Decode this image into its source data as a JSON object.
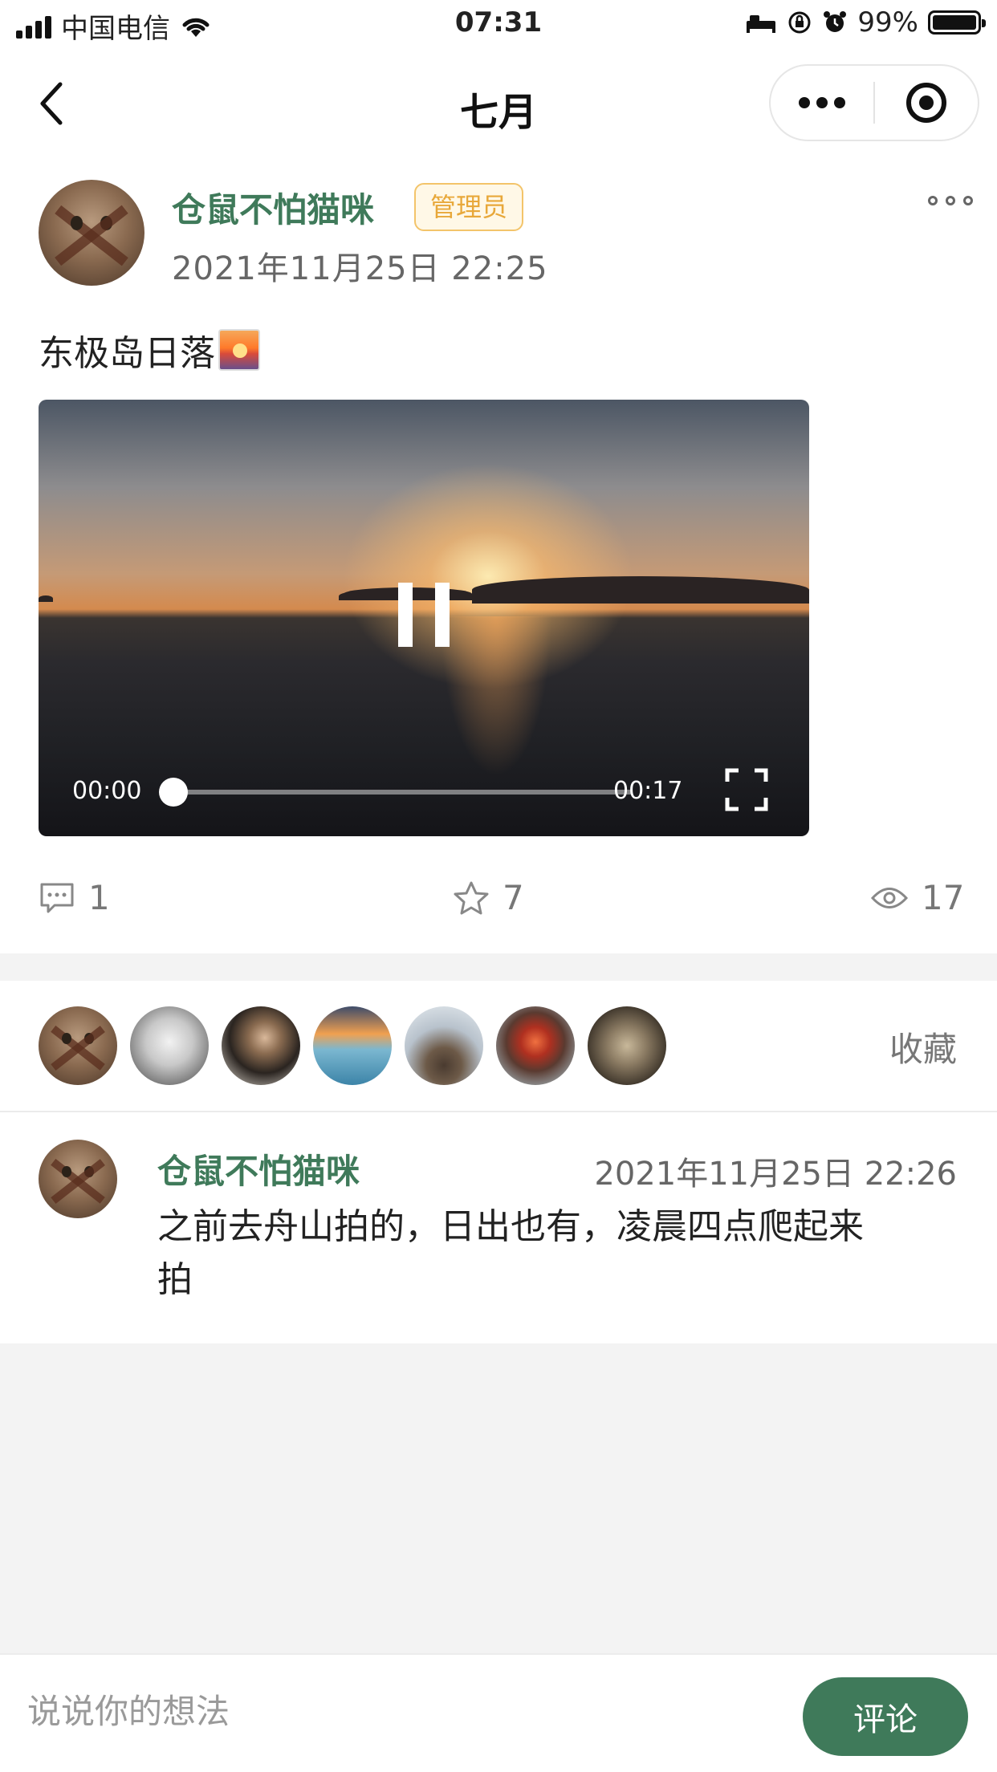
{
  "status_bar": {
    "carrier": "中国电信",
    "time": "07:31",
    "battery": "99%"
  },
  "nav": {
    "title": "七月"
  },
  "post": {
    "author": "仓鼠不怕猫咪",
    "badge": "管理员",
    "time": "2021年11月25日  22:25",
    "text": "东极岛日落",
    "emoji_icon": "sunset-emoji-icon",
    "video": {
      "current": "00:00",
      "duration": "00:17",
      "progress": 0.0,
      "state": "playing"
    },
    "stats": {
      "comments": "1",
      "favorites": "7",
      "views": "17"
    }
  },
  "favorites": {
    "label": "收藏",
    "count_avatars": 7
  },
  "comment": {
    "author": "仓鼠不怕猫咪",
    "time": "2021年11月25日  22:26",
    "text": "之前去舟山拍的，日出也有，凌晨四点爬起来拍"
  },
  "composer": {
    "placeholder": "说说你的想法",
    "submit": "评论"
  },
  "colors": {
    "accent": "#3f7a5a",
    "badge_border": "#f3c46a",
    "badge_text": "#e8a83a",
    "muted": "#777777"
  }
}
